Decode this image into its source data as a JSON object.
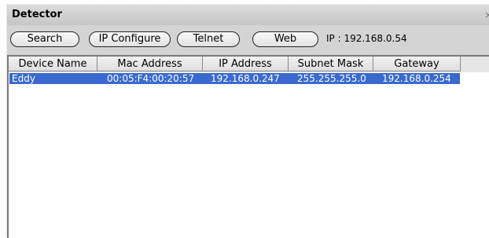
{
  "window": {
    "title": "Detector",
    "close_glyph": "×"
  },
  "toolbar": {
    "buttons": [
      "Search",
      "IP Configure",
      "Telnet",
      "Web"
    ],
    "ip_label": "IP : 192.168.0.54"
  },
  "table": {
    "columns": [
      "Device Name",
      "Mac Address",
      "IP Address",
      "Subnet Mask",
      "Gateway"
    ],
    "rows": [
      {
        "device_name": "Eddy",
        "mac": "00:05:F4:00:20:57",
        "ip": "192.168.0.247",
        "subnet": "255.255.255.0",
        "gateway": "192.168.0.254",
        "selected": true
      }
    ]
  },
  "colors": {
    "selection": "#3a6ad0",
    "frame": "#d4d4d4"
  }
}
